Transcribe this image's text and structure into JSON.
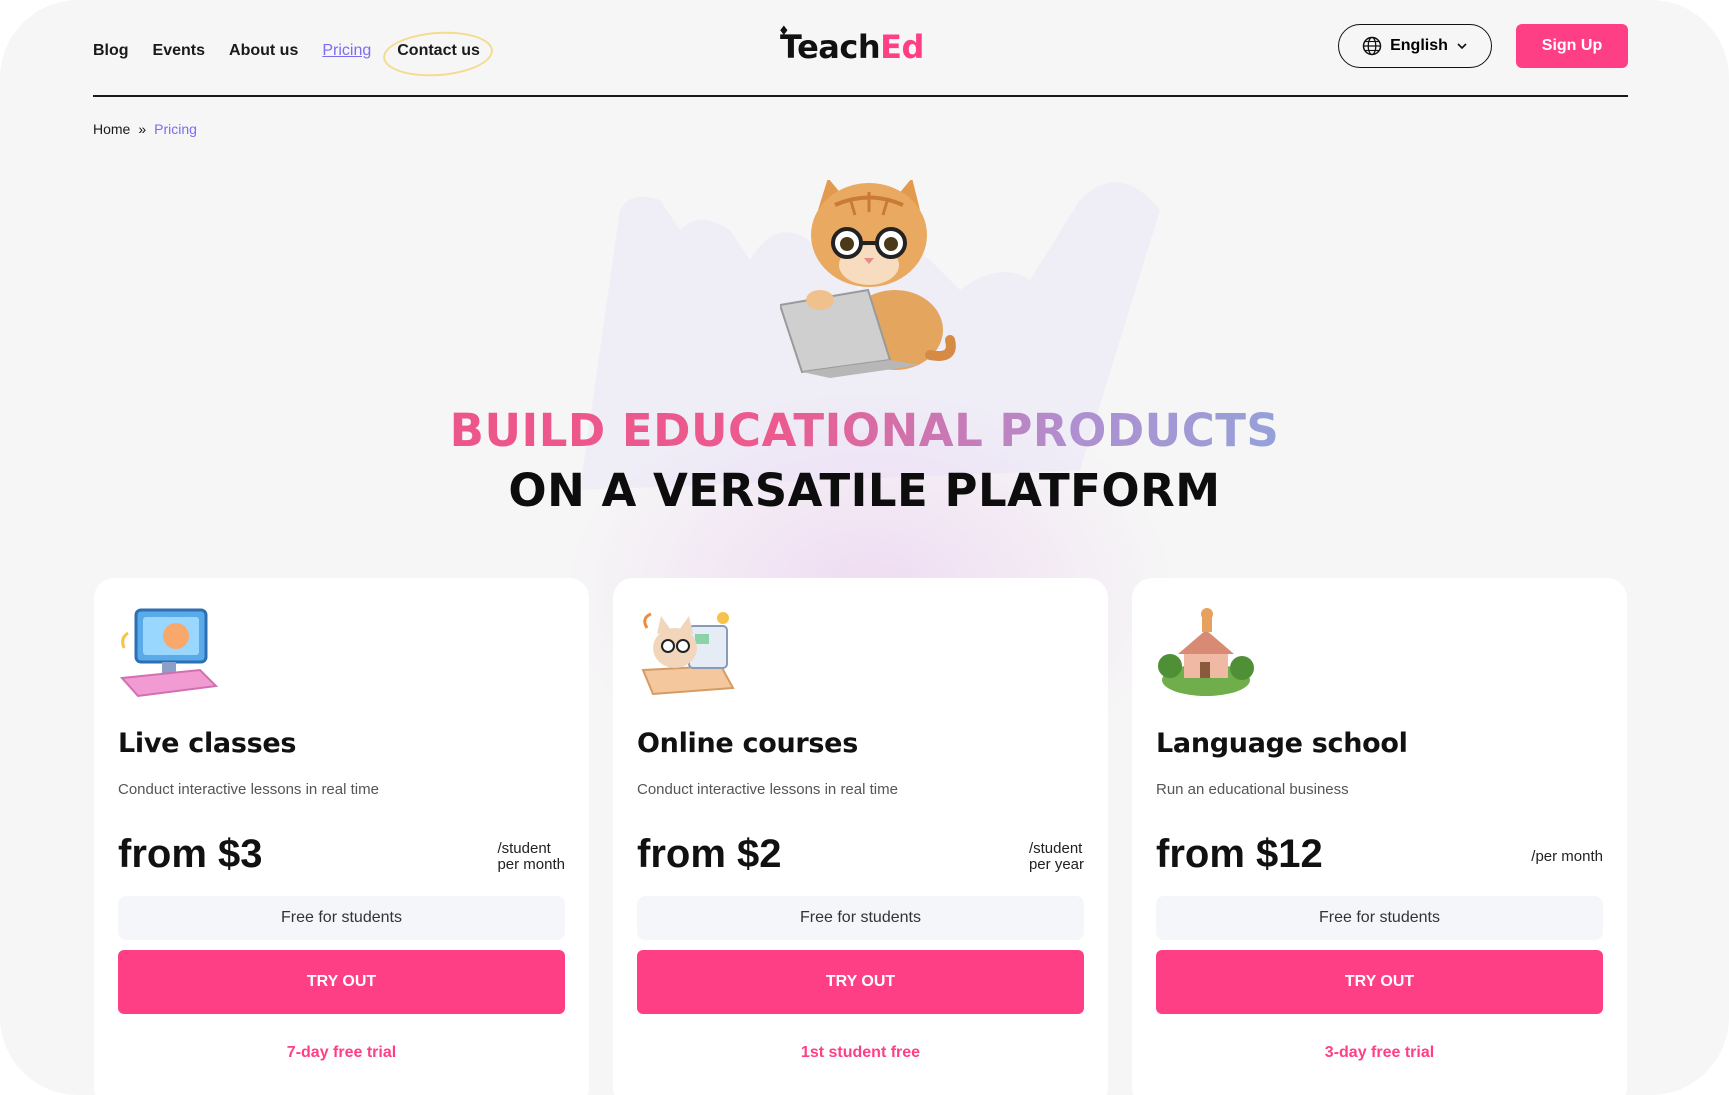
{
  "nav": {
    "items": [
      {
        "label": "Blog"
      },
      {
        "label": "Events"
      },
      {
        "label": "About us"
      },
      {
        "label": "Pricing"
      },
      {
        "label": "Contact us"
      }
    ]
  },
  "logo": {
    "part1": "Teach",
    "part2": "Ed"
  },
  "language": {
    "label": "English"
  },
  "signup": {
    "label": "Sign Up"
  },
  "breadcrumb": {
    "home": "Home",
    "separator": "»",
    "current": "Pricing"
  },
  "hero": {
    "line1": "BUILD EDUCATIONAL PRODUCTS",
    "line2": "ON A VERSATILE PLATFORM"
  },
  "cards": [
    {
      "title": "Live classes",
      "desc": "Conduct interactive lessons in real time",
      "price": "from $3",
      "unit": "/student\nper month",
      "free": "Free for students",
      "button": "TRY OUT",
      "trial": "7-day free trial"
    },
    {
      "title": "Online courses",
      "desc": "Conduct interactive lessons in real time",
      "price": "from $2",
      "unit": "/student\nper year",
      "free": "Free for students",
      "button": "TRY OUT",
      "trial": "1st student free"
    },
    {
      "title": "Language school",
      "desc": "Run an educational business",
      "price": "from $12",
      "unit": "/per month",
      "free": "Free for students",
      "button": "TRY OUT",
      "trial": "3-day free trial"
    }
  ],
  "colors": {
    "accent": "#ff3f85",
    "link": "#7b6cf0",
    "background": "#f6f6f6"
  }
}
